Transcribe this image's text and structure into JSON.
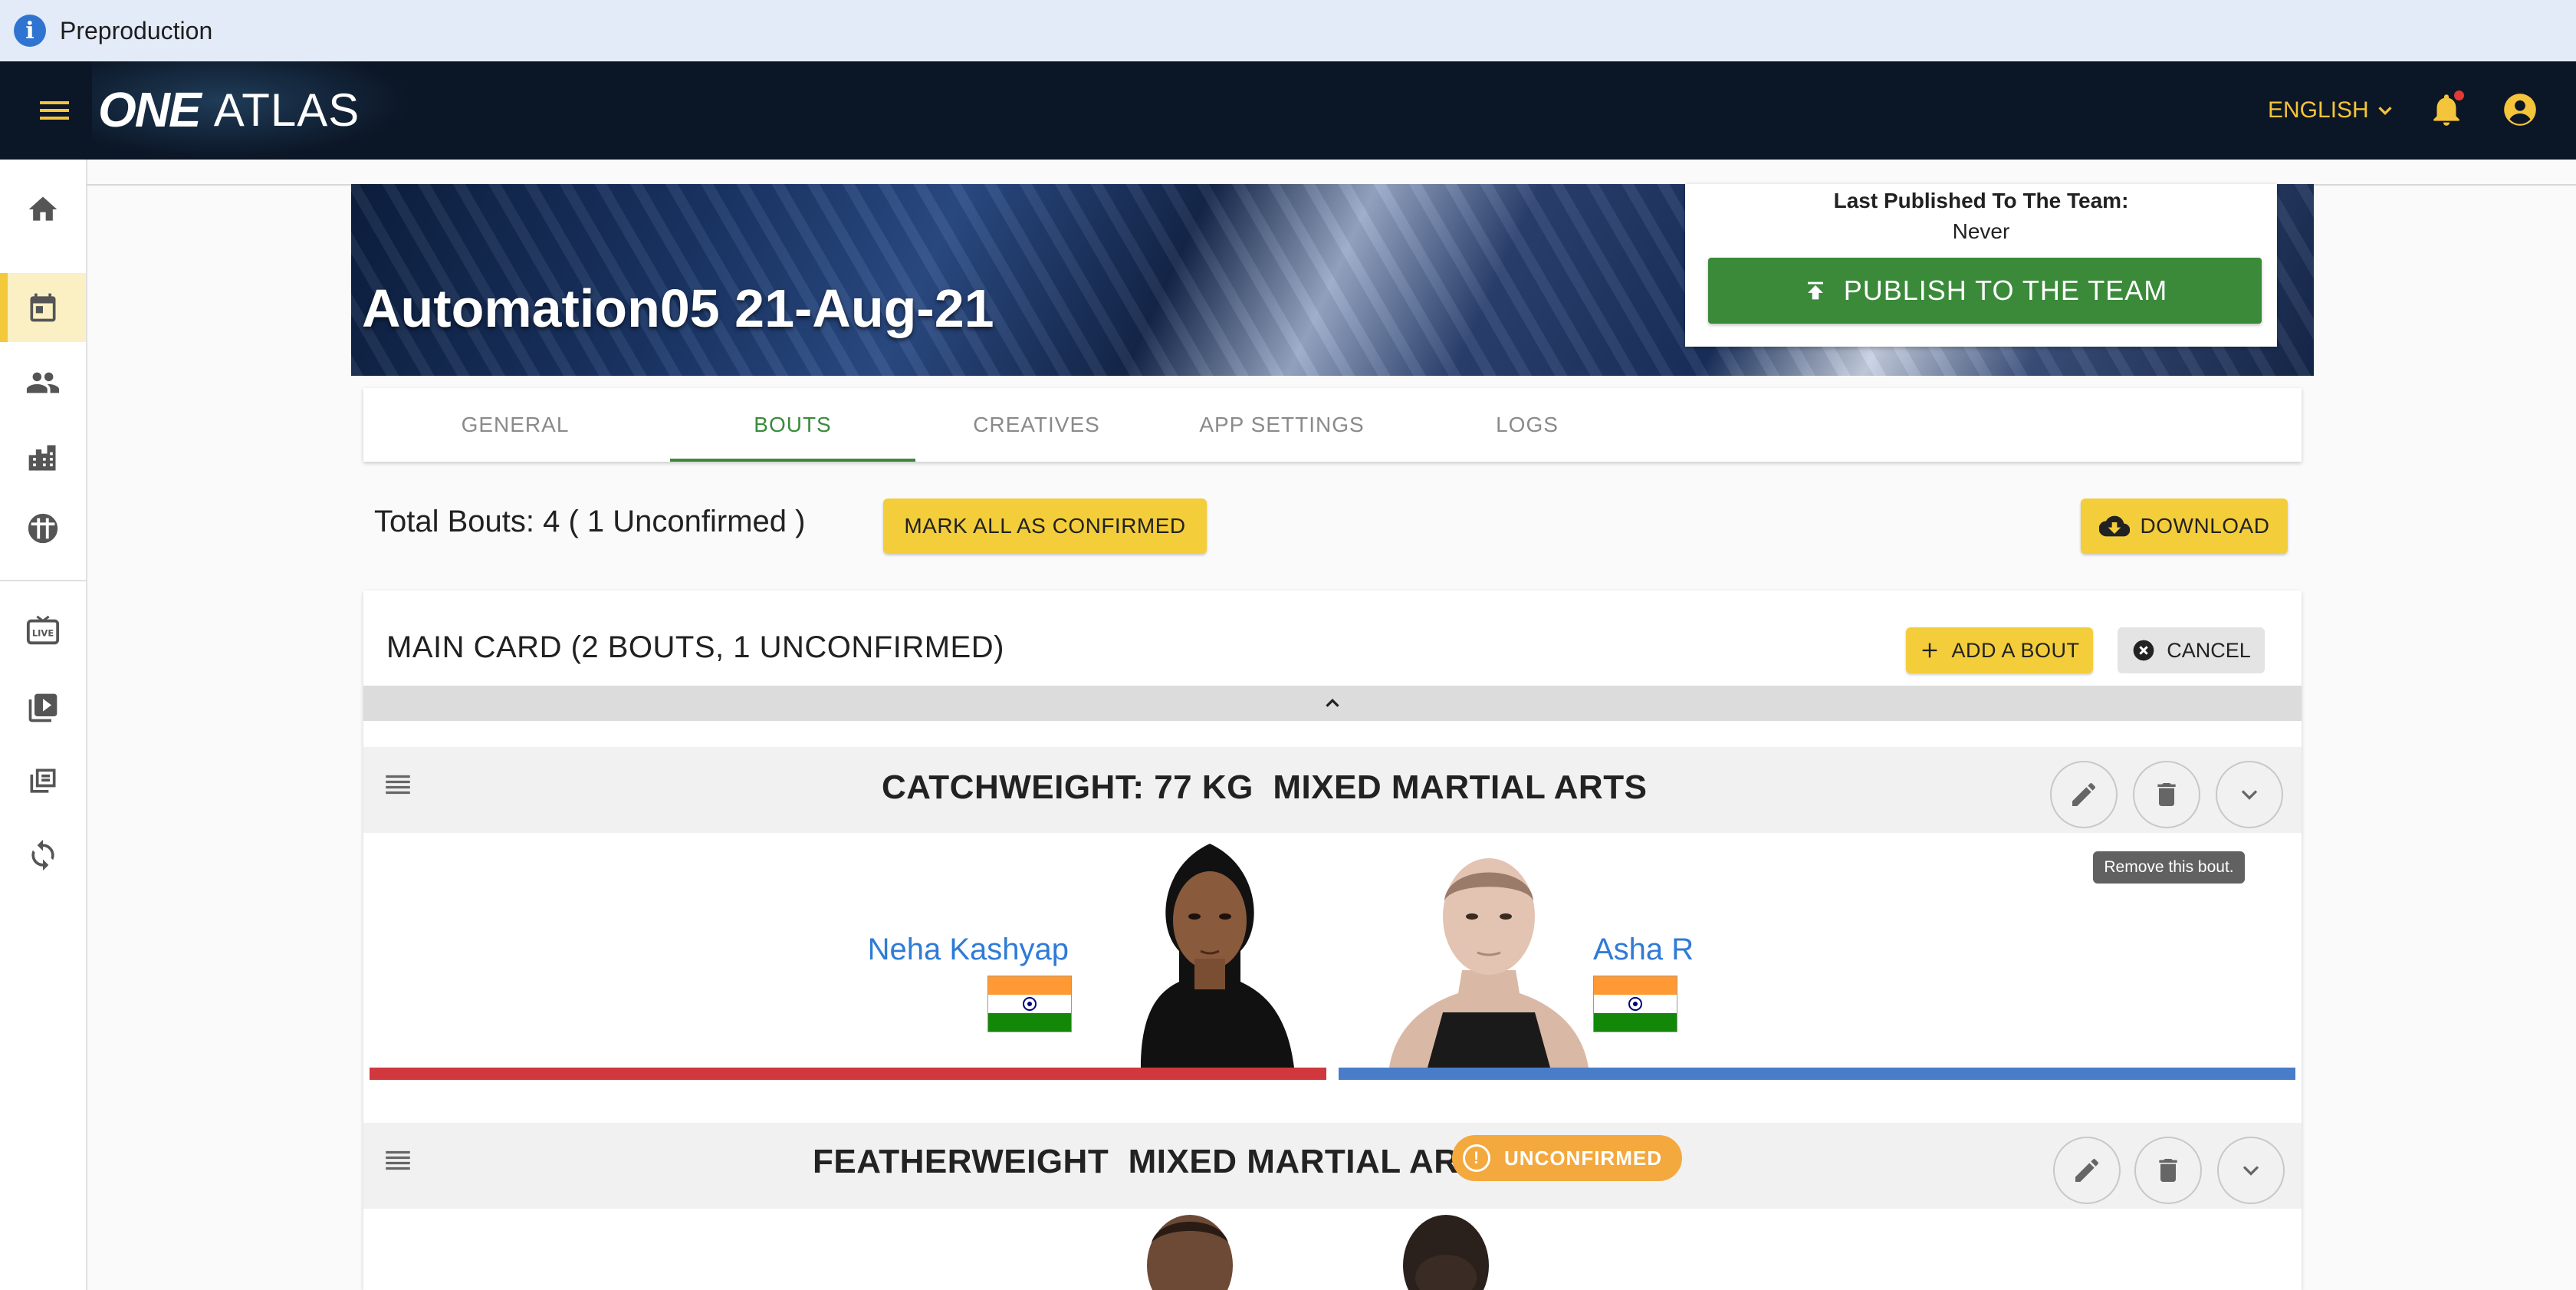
{
  "env_banner": {
    "text": "Preproduction"
  },
  "topnav": {
    "logo_one": "ONE",
    "logo_atlas": "ATLAS",
    "language": "ENGLISH"
  },
  "event": {
    "title": "Automation05 21-Aug-21",
    "last_published_label": "Last Published To The Team:",
    "last_published_value": "Never",
    "publish_button": "PUBLISH TO THE TEAM"
  },
  "tabs": [
    {
      "label": "GENERAL"
    },
    {
      "label": "BOUTS",
      "active": true
    },
    {
      "label": "CREATIVES"
    },
    {
      "label": "APP SETTINGS"
    },
    {
      "label": "LOGS"
    }
  ],
  "summary": {
    "total_text": "Total Bouts: 4 ( 1 Unconfirmed )",
    "mark_all_button": "MARK ALL AS CONFIRMED",
    "download_button": "DOWNLOAD"
  },
  "main_card": {
    "title": "MAIN CARD (2 BOUTS, 1 UNCONFIRMED)",
    "add_bout_button": "ADD A BOUT",
    "cancel_button": "CANCEL",
    "bouts": [
      {
        "weight_class": "CATCHWEIGHT: 77 KG",
        "discipline": "MIXED MARTIAL ARTS",
        "red_corner": {
          "name": "Neha Kashyap",
          "flag": "India"
        },
        "blue_corner": {
          "name": "Asha R",
          "flag": "India"
        },
        "delete_tooltip": "Remove this bout."
      },
      {
        "weight_class": "FEATHERWEIGHT",
        "discipline": "MIXED MARTIAL ARTS",
        "status": "UNCONFIRMED"
      }
    ]
  },
  "colors": {
    "brand_yellow": "#f4cd3b",
    "publish_green": "#3a8a3a",
    "red_corner": "#d0383d",
    "blue_corner": "#4a7dc9",
    "unconfirmed": "#f3a93e",
    "fighter_name": "#2f7bd6"
  },
  "icons": [
    "info-icon",
    "menu-icon",
    "chevron-down-icon",
    "bell-icon",
    "account-icon",
    "home-icon",
    "calendar-icon",
    "people-icon",
    "building-icon",
    "shield-icon",
    "live-tv-icon",
    "video-library-icon",
    "collections-icon",
    "sync-icon",
    "upload-icon",
    "cloud-download-icon",
    "plus-icon",
    "close-circle-icon",
    "chevron-up-icon",
    "drag-handle-icon",
    "pencil-icon",
    "trash-icon",
    "alert-icon"
  ]
}
